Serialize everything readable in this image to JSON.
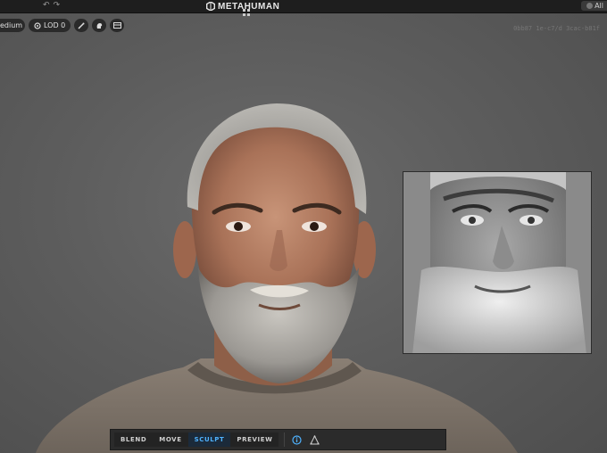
{
  "app": {
    "brand": "METAHUMAN",
    "undo_icon": "undo-icon",
    "redo_icon": "redo-icon"
  },
  "topbar_right": {
    "label": "All"
  },
  "viewport_toolbar": {
    "quality_label": "edium",
    "lod_label": "LOD 0",
    "tools": [
      "wand-icon",
      "head-icon",
      "layout-icon"
    ]
  },
  "asset_id": "0bb87 1e-c7/d 3cac-b81f",
  "bottom_toolbar": {
    "modes": [
      {
        "label": "BLEND",
        "active": false
      },
      {
        "label": "MOVE",
        "active": false
      },
      {
        "label": "SCULPT",
        "active": true
      },
      {
        "label": "PREVIEW",
        "active": false
      }
    ],
    "tool_icons": [
      "info-icon",
      "landmarks-icon"
    ]
  },
  "colors": {
    "accent": "#4fb2ff",
    "toolbar_bg": "#2b2b2b",
    "viewport_bg": "#5d5d5d"
  }
}
